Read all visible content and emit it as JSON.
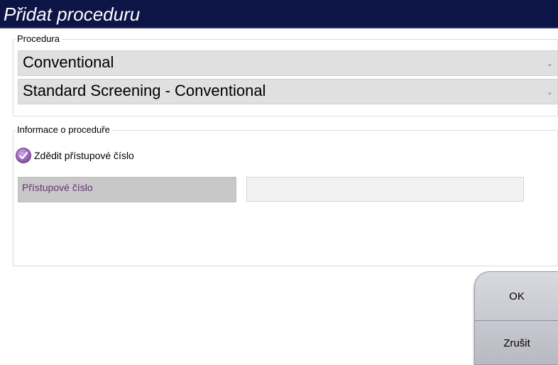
{
  "dialog": {
    "title": "Přidat proceduru"
  },
  "procedure_group": {
    "label": "Procedura",
    "procedure_type": {
      "value": "Conventional"
    },
    "procedure_name": {
      "value": "Standard Screening - Conventional"
    }
  },
  "info_group": {
    "label": "Informace o proceduře",
    "inherit_checkbox": {
      "label": "Zdědit přístupové číslo",
      "checked": true
    },
    "accession": {
      "label": "Přístupové číslo",
      "value": ""
    }
  },
  "buttons": {
    "ok": "OK",
    "cancel": "Zrušit"
  },
  "icons": {
    "dropdown": "chevron-down-icon",
    "check": "checkmark-icon"
  },
  "colors": {
    "title_bar": "#0d1446",
    "checkbox": "#8b4fae",
    "accession_label_text": "#6b2d79"
  }
}
